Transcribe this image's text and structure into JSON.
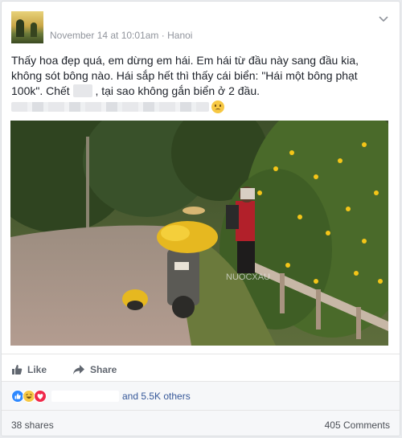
{
  "post": {
    "timestamp": "November 14 at 10:01am",
    "location_separator": "·",
    "location": "Hanoi",
    "text_part1": "Thấy hoa đẹp quá, em dừng em hái. Em hái từ đầu này sang đầu kia, không sót bông nào. Hái sắp hết thì thấy cái biển: \"Hái một bông phạt 100k\". Chết",
    "text_part2": ", tại sao không gắn biển ở 2 đầu.",
    "watermark": "NUOCXAU"
  },
  "actions": {
    "like_label": "Like",
    "share_label": "Share"
  },
  "reactions": {
    "summary": "and 5.5K others",
    "icons": [
      "like-icon",
      "haha-icon",
      "love-icon"
    ]
  },
  "stats": {
    "shares": "38 shares",
    "comments": "405 Comments"
  },
  "colors": {
    "link": "#365899",
    "meta": "#90949c",
    "like": "#2d88ff",
    "love": "#f0284a",
    "flower": "#f4c518"
  }
}
